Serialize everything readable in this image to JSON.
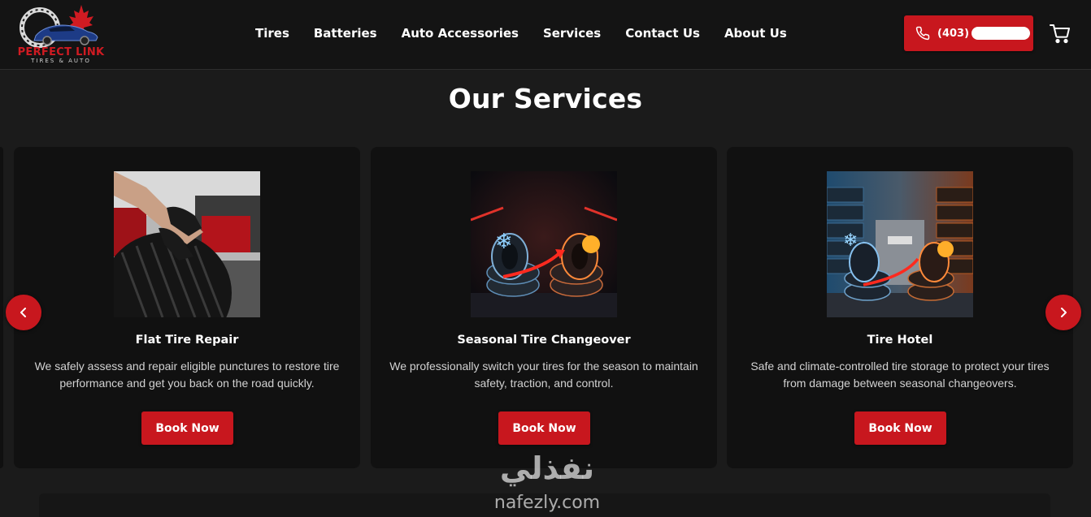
{
  "brand": {
    "logo_title": "PERFECT LINK",
    "logo_subtitle": "TIRES & AUTO",
    "accent": "#c8171e"
  },
  "nav": {
    "items": [
      {
        "label": "Tires"
      },
      {
        "label": "Batteries"
      },
      {
        "label": "Auto Accessories"
      },
      {
        "label": "Services"
      },
      {
        "label": "Contact Us"
      },
      {
        "label": "About Us"
      }
    ]
  },
  "header": {
    "phone_label": "(403)",
    "phone_icon": "phone-icon",
    "cart_icon": "cart-icon"
  },
  "services": {
    "title": "Our Services",
    "cards": [
      {
        "title": "Flat Tire Repair",
        "description": "We safely assess and repair eligible punctures to restore tire performance and get you back on the road quickly.",
        "button": "Book Now"
      },
      {
        "title": "Seasonal Tire Changeover",
        "description": "We professionally switch your tires for the season to maintain safety, traction, and control.",
        "button": "Book Now"
      },
      {
        "title": "Tire Hotel",
        "description": "Safe and climate-controlled tire storage to protect your tires from damage between seasonal changeovers.",
        "button": "Book Now"
      }
    ],
    "prev_icon": "chevron-left-icon",
    "next_icon": "chevron-right-icon"
  },
  "watermark": {
    "arabic": "نفذلي",
    "latin": "nafezly.com"
  }
}
